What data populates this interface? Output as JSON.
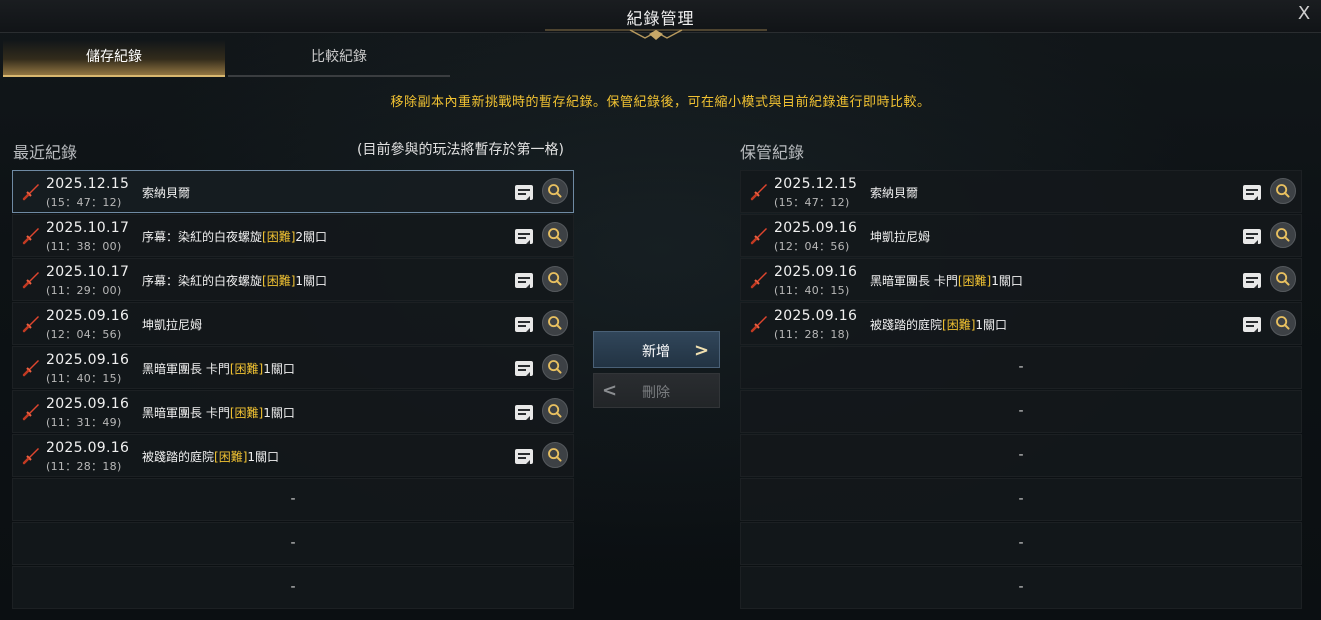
{
  "window": {
    "title": "紀錄管理",
    "close_label": "X"
  },
  "tabs": [
    {
      "label": "儲存紀錄",
      "active": true
    },
    {
      "label": "比較紀錄",
      "active": false
    }
  ],
  "notice": "移除副本內重新挑戰時的暫存紀錄。保管紀錄後，可在縮小模式與目前紀錄進行即時比較。",
  "recent": {
    "title": "最近紀錄",
    "note": "(目前參與的玩法將暫存於第一格)",
    "rows": [
      {
        "date": "2025.12.15",
        "time": "(15：47：12)",
        "name_pre": "索納貝爾",
        "hard": "",
        "name_post": ""
      },
      {
        "date": "2025.10.17",
        "time": "(11：38：00)",
        "name_pre": "序幕：染紅的白夜螺旋",
        "hard": "[困難]",
        "name_post": "2關口"
      },
      {
        "date": "2025.10.17",
        "time": "(11：29：00)",
        "name_pre": "序幕：染紅的白夜螺旋",
        "hard": "[困難]",
        "name_post": "1關口"
      },
      {
        "date": "2025.09.16",
        "time": "(12：04：56)",
        "name_pre": "坤凱拉尼姆",
        "hard": "",
        "name_post": ""
      },
      {
        "date": "2025.09.16",
        "time": "(11：40：15)",
        "name_pre": "黑暗軍團長 卡門",
        "hard": "[困難]",
        "name_post": "1關口"
      },
      {
        "date": "2025.09.16",
        "time": "(11：31：49)",
        "name_pre": "黑暗軍團長 卡門",
        "hard": "[困難]",
        "name_post": "1關口"
      },
      {
        "date": "2025.09.16",
        "time": "(11：28：18)",
        "name_pre": "被踐踏的庭院",
        "hard": "[困難]",
        "name_post": "1關口"
      }
    ],
    "empty_rows": [
      "-",
      "-",
      "-"
    ]
  },
  "kept": {
    "title": "保管紀錄",
    "rows": [
      {
        "date": "2025.12.15",
        "time": "(15：47：12)",
        "name_pre": "索納貝爾",
        "hard": "",
        "name_post": ""
      },
      {
        "date": "2025.09.16",
        "time": "(12：04：56)",
        "name_pre": "坤凱拉尼姆",
        "hard": "",
        "name_post": ""
      },
      {
        "date": "2025.09.16",
        "time": "(11：40：15)",
        "name_pre": "黑暗軍團長 卡門",
        "hard": "[困難]",
        "name_post": "1關口"
      },
      {
        "date": "2025.09.16",
        "time": "(11：28：18)",
        "name_pre": "被踐踏的庭院",
        "hard": "[困難]",
        "name_post": "1關口"
      }
    ],
    "empty_rows": [
      "-",
      "-",
      "-",
      "-",
      "-",
      "-"
    ]
  },
  "buttons": {
    "add": "新增",
    "add_arrow": ">",
    "delete": "刪除",
    "delete_arrow": "<"
  },
  "colors": {
    "accent_gold": "#f1c232",
    "selected_border": "#6f8aa3",
    "button_blue": "#2a3e50"
  }
}
